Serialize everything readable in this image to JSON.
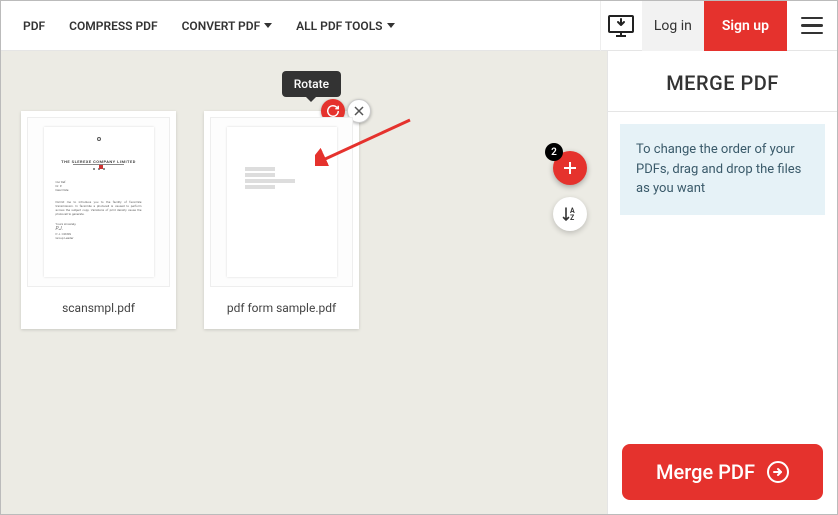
{
  "nav": {
    "items": [
      "PDF",
      "COMPRESS PDF",
      "CONVERT PDF",
      "ALL PDF TOOLS"
    ]
  },
  "auth": {
    "login": "Log in",
    "signup": "Sign up"
  },
  "tooltip": {
    "rotate": "Rotate"
  },
  "files": [
    {
      "name": "scansmpl.pdf"
    },
    {
      "name": "pdf form sample.pdf"
    }
  ],
  "add": {
    "count": "2"
  },
  "sidebar": {
    "title": "MERGE PDF",
    "tip": "To change the order of your PDFs, drag and drop the files as you want",
    "cta": "Merge PDF"
  }
}
